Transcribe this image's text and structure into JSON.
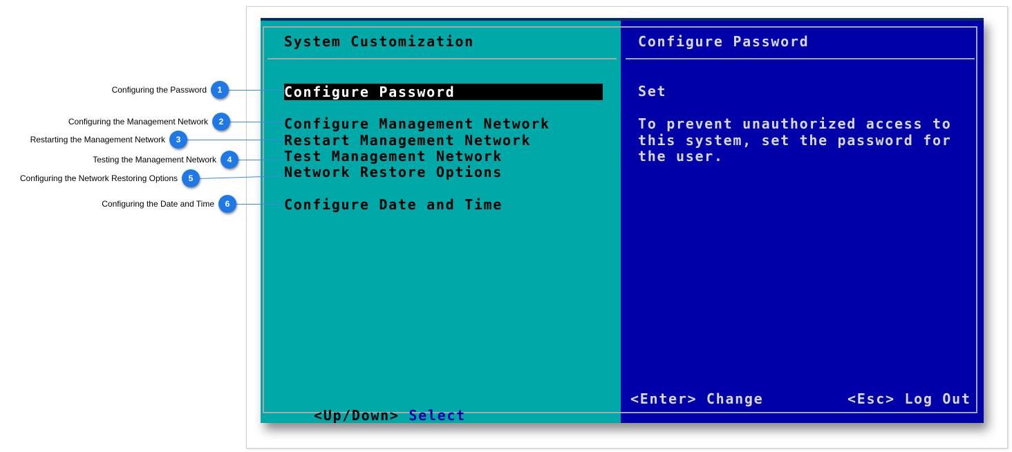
{
  "console": {
    "left_title": "System Customization",
    "right_title": "Configure Password",
    "menu": [
      "Configure Password",
      "Configure Management Network",
      "Restart Management Network",
      "Test Management Network",
      "Network Restore Options",
      "Configure Date and Time"
    ],
    "detail_value": "Set",
    "description": [
      "To prevent unauthorized access to",
      "this system, set the password for",
      "the user."
    ],
    "footer": {
      "nav_key": "<Up/Down>",
      "nav_action": "Select",
      "enter_hint": "<Enter> Change",
      "esc_hint": "<Esc> Log Out"
    }
  },
  "callouts": [
    {
      "number": "1",
      "label": "Configuring the Password"
    },
    {
      "number": "2",
      "label": "Configuring the Management Network"
    },
    {
      "number": "3",
      "label": "Restarting the Management Network"
    },
    {
      "number": "4",
      "label": "Testing the Management Network"
    },
    {
      "number": "5",
      "label": "Configuring the Network Restoring Options"
    },
    {
      "number": "6",
      "label": "Configuring the Date and Time"
    }
  ],
  "colors": {
    "left_pane": "#00a8a8",
    "right_pane": "#0000a8",
    "badge": "#1e78e6"
  }
}
